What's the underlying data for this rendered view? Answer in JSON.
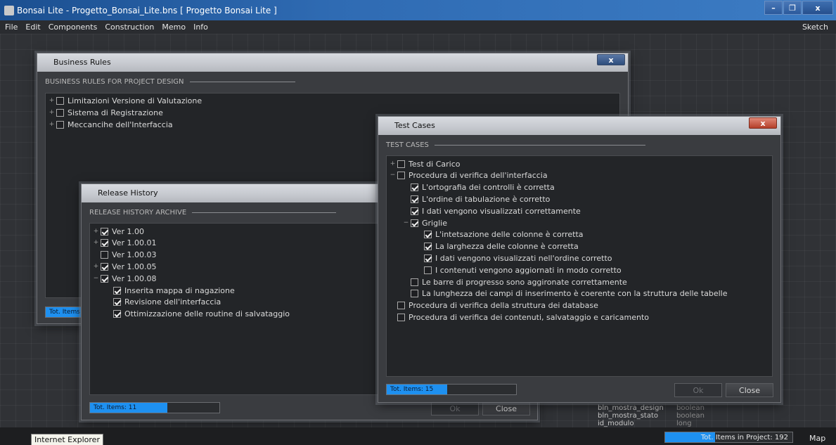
{
  "window": {
    "title": "Bonsai Lite  - Progetto_Bonsai_Lite.bns  [ Progetto Bonsai Lite ]",
    "min": "–",
    "max": "❐",
    "close": "x"
  },
  "menu": {
    "items": [
      "File",
      "Edit",
      "Components",
      "Construction",
      "Memo",
      "Info"
    ],
    "right": "Sketch"
  },
  "business": {
    "title": "Business Rules",
    "section": "BUSINESS RULES FOR PROJECT DESIGN",
    "close": "x",
    "items": [
      {
        "label": "Limitazioni Versione di Valutazione",
        "checked": false
      },
      {
        "label": "Sistema di Registrazione",
        "checked": false
      },
      {
        "label": "Meccancihe dell'Interfaccia",
        "checked": false
      }
    ],
    "total": "Tot. Items"
  },
  "release": {
    "title": "Release History",
    "section": "RELEASE HISTORY ARCHIVE",
    "total": "Tot. Items: 11",
    "total_fraction": 0.6,
    "ok": "Ok",
    "close": "Close",
    "items": [
      {
        "label": "Ver 1.00",
        "checked": true,
        "level": 0,
        "exp": "+"
      },
      {
        "label": "Ver 1.00.01",
        "checked": true,
        "level": 0,
        "exp": "+"
      },
      {
        "label": "Ver 1.00.03",
        "checked": false,
        "level": 0,
        "exp": ""
      },
      {
        "label": "Ver 1.00.05",
        "checked": true,
        "level": 0,
        "exp": "+"
      },
      {
        "label": "Ver 1.00.08",
        "checked": true,
        "level": 0,
        "exp": "−"
      },
      {
        "label": "Inserita mappa di nagazione",
        "checked": true,
        "level": 1,
        "exp": ""
      },
      {
        "label": "Revisione dell'interfaccia",
        "checked": true,
        "level": 1,
        "exp": ""
      },
      {
        "label": "Ottimizzazione delle routine di salvataggio",
        "checked": true,
        "level": 1,
        "exp": ""
      }
    ]
  },
  "testcases": {
    "title": "Test Cases",
    "section": "TEST CASES",
    "close": "x",
    "total": "Tot. Items: 15",
    "total_fraction": 0.47,
    "ok": "Ok",
    "cancel": "Close",
    "items": [
      {
        "label": "Test di Carico",
        "checked": false,
        "level": 0,
        "exp": "+"
      },
      {
        "label": "Procedura di verifica dell'interfaccia",
        "checked": false,
        "level": 0,
        "exp": "−"
      },
      {
        "label": "L'ortografia dei controlli è corretta",
        "checked": true,
        "level": 1,
        "exp": ""
      },
      {
        "label": "L'ordine di tabulazione è corretto",
        "checked": true,
        "level": 1,
        "exp": ""
      },
      {
        "label": "I dati vengono visualizzati correttamente",
        "checked": true,
        "level": 1,
        "exp": ""
      },
      {
        "label": "Griglie",
        "checked": true,
        "level": 1,
        "exp": "−"
      },
      {
        "label": "L'intetsazione delle colonne è corretta",
        "checked": true,
        "level": 2,
        "exp": ""
      },
      {
        "label": "La larghezza delle colonne è corretta",
        "checked": true,
        "level": 2,
        "exp": ""
      },
      {
        "label": "I dati vengono visualizzati nell'ordine corretto",
        "checked": true,
        "level": 2,
        "exp": ""
      },
      {
        "label": "I contenuti vengono aggiornati in modo corretto",
        "checked": false,
        "level": 2,
        "exp": ""
      },
      {
        "label": "Le barre di progresso sono aggironate correttamente",
        "checked": false,
        "level": 1,
        "exp": ""
      },
      {
        "label": "La lunghezza dei campi di inserimento è coerente con la struttura delle tabelle",
        "checked": false,
        "level": 1,
        "exp": ""
      },
      {
        "label": "Procedura di verifica della struttura dei database",
        "checked": false,
        "level": 0,
        "exp": ""
      },
      {
        "label": "Procedura di verifica dei contenuti, salvataggio e caricamento",
        "checked": false,
        "level": 0,
        "exp": ""
      }
    ]
  },
  "background_columns": {
    "names": [
      "bln_mostra_design",
      "bln_mostra_stato",
      "id_modulo"
    ],
    "types": [
      "boolean",
      "boolean",
      "long"
    ]
  },
  "status": {
    "tooltip": "Internet Explorer",
    "total": "Tot. Items in Project: 192",
    "total_fraction": 0.39,
    "map": "Map"
  }
}
